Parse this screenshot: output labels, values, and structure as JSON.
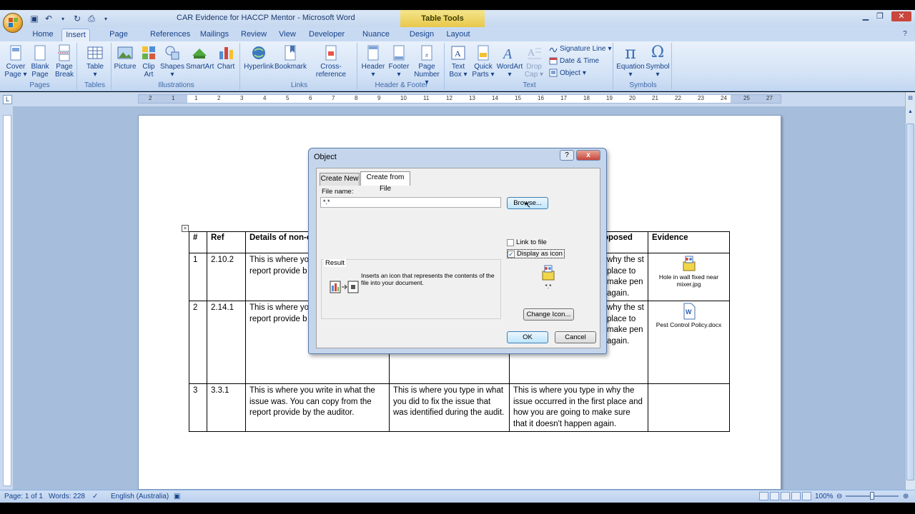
{
  "window": {
    "title": "CAR Evidence for HACCP Mentor - Microsoft Word",
    "contextual_tab": "Table Tools"
  },
  "ribbon_tabs": [
    {
      "label": "Home",
      "active": false
    },
    {
      "label": "Insert",
      "active": true
    },
    {
      "label": "Page Layout",
      "active": false
    },
    {
      "label": "References",
      "active": false
    },
    {
      "label": "Mailings",
      "active": false
    },
    {
      "label": "Review",
      "active": false
    },
    {
      "label": "View",
      "active": false
    },
    {
      "label": "Developer",
      "active": false
    },
    {
      "label": "Nuance PDF",
      "active": false
    },
    {
      "label": "Design",
      "active": false
    },
    {
      "label": "Layout",
      "active": false
    }
  ],
  "ribbon": {
    "pages": {
      "label": "Pages",
      "buttons": [
        "Cover Page",
        "Blank Page",
        "Page Break"
      ]
    },
    "tables": {
      "label": "Tables",
      "buttons": [
        "Table"
      ]
    },
    "illustrations": {
      "label": "Illustrations",
      "buttons": [
        "Picture",
        "Clip Art",
        "Shapes",
        "SmartArt",
        "Chart"
      ]
    },
    "links": {
      "label": "Links",
      "buttons": [
        "Hyperlink",
        "Bookmark",
        "Cross-reference"
      ]
    },
    "header_footer": {
      "label": "Header & Footer",
      "buttons": [
        "Header",
        "Footer",
        "Page Number"
      ]
    },
    "text": {
      "label": "Text",
      "buttons": [
        "Text Box",
        "Quick Parts",
        "WordArt",
        "Drop Cap"
      ],
      "small": [
        "Signature Line",
        "Date & Time",
        "Object"
      ]
    },
    "symbols": {
      "label": "Symbols",
      "buttons": [
        "Equation",
        "Symbol"
      ]
    }
  },
  "table": {
    "headers": [
      "#",
      "Ref",
      "Details of non-co",
      "",
      "oposed",
      "Evidence"
    ],
    "rows": [
      {
        "num": "1",
        "ref": "2.10.2",
        "details": "This is where you issue was. You c report provide b",
        "action": "",
        "cause": "why the st place to make pen again.",
        "evidence_file": "Hole in wall fixed near mixer.jpg"
      },
      {
        "num": "2",
        "ref": "2.14.1",
        "details": "This is where you issue was. You c report provide b",
        "action": "",
        "cause": "why the st place to make pen again.",
        "evidence_file": "Pest Control Policy.docx"
      },
      {
        "num": "3",
        "ref": "3.3.1",
        "details": "This is where you write in what the issue was. You can copy from the report provide by the auditor.",
        "action": "This is where you type in what you did to fix the issue that was identified during the audit.",
        "cause": "This is where you type in why the issue occurred in the first place and how you are going to make sure that it doesn't happen again.",
        "evidence_file": ""
      }
    ]
  },
  "dialog": {
    "title": "Object",
    "tabs": [
      "Create New",
      "Create from File"
    ],
    "active_tab": "Create from File",
    "file_name_label": "File name:",
    "file_name_value": "*.*",
    "browse_label": "Browse...",
    "link_to_file": {
      "label": "Link to file",
      "checked": false
    },
    "display_as_icon": {
      "label": "Display as icon",
      "checked": true
    },
    "icon_caption": "*.*",
    "result_label": "Result",
    "result_text": "Inserts an icon that represents the contents of the file into your document.",
    "change_icon_label": "Change Icon...",
    "ok_label": "OK",
    "cancel_label": "Cancel",
    "help_label": "?",
    "close_label": "x"
  },
  "statusbar": {
    "page": "Page: 1 of 1",
    "words": "Words: 228",
    "language": "English (Australia)",
    "zoom": "100%"
  },
  "ruler_marks": [
    "2",
    "1",
    "1",
    "2",
    "3",
    "4",
    "5",
    "6",
    "7",
    "8",
    "9",
    "10",
    "11",
    "12",
    "13",
    "14",
    "15",
    "16",
    "17",
    "18",
    "19",
    "20",
    "21",
    "22",
    "23",
    "24",
    "25",
    "27"
  ]
}
